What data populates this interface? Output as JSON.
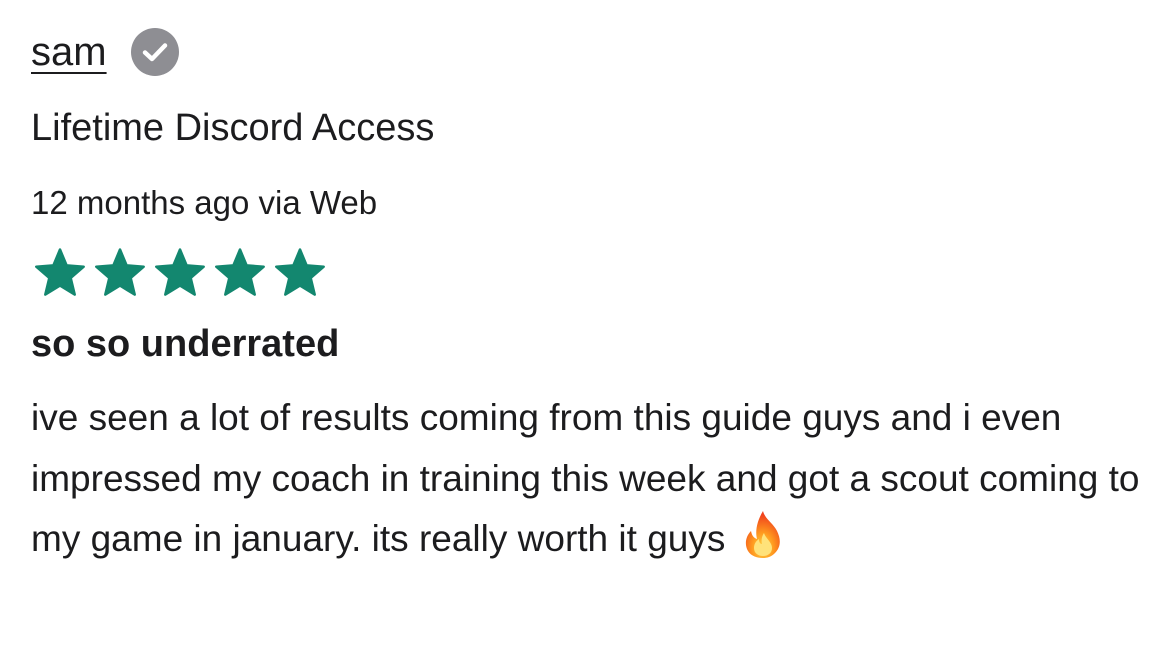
{
  "review": {
    "author": "sam",
    "verified_icon": "check-circle-icon",
    "product": "Lifetime Discord Access",
    "meta": "12 months ago via Web",
    "rating": 5,
    "rating_max": 5,
    "star_color": "#13876f",
    "title": "so so underrated",
    "body": "ive seen a lot of results coming from this guide guys and i even impressed my coach in training this week and got a scout coming to my game in january. its really worth it guys",
    "emoji_icon": "fire-icon"
  }
}
